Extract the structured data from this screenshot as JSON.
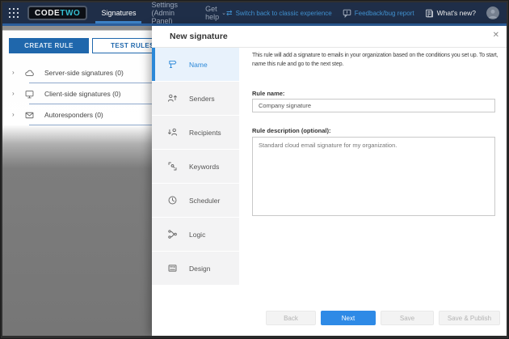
{
  "glyphs": {
    "chevron_right": "›",
    "caret_down": "⌄",
    "close": "✕",
    "switch_arrows": "⇄"
  },
  "nav": {
    "logo_part1": "CODE",
    "logo_part2": "TWO",
    "tabs": [
      {
        "label": "Signatures",
        "active": true
      },
      {
        "label": "Settings (Admin Panel)",
        "active": false
      },
      {
        "label": "Get help",
        "active": false
      }
    ],
    "links": [
      {
        "label": "Switch back to classic experience",
        "icon": "switch-arrows-icon"
      },
      {
        "label": "Feedback/bug report",
        "icon": "feedback-bubble-icon"
      },
      {
        "label": "What's new?",
        "icon": "whats-new-icon"
      }
    ]
  },
  "sidebar": {
    "create_rule_label": "CREATE RULE",
    "test_rules_label": "TEST RULES",
    "groups": [
      {
        "label": "Server-side signatures (0)",
        "icon": "cloud-icon"
      },
      {
        "label": "Client-side signatures (0)",
        "icon": "monitor-icon"
      },
      {
        "label": "Autoresponders (0)",
        "icon": "autoresponder-icon"
      }
    ]
  },
  "modal": {
    "title": "New signature",
    "steps": [
      {
        "label": "Name",
        "icon": "signpost-icon",
        "active": true
      },
      {
        "label": "Senders",
        "icon": "sender-person-icon",
        "active": false
      },
      {
        "label": "Recipients",
        "icon": "recipient-person-icon",
        "active": false
      },
      {
        "label": "Keywords",
        "icon": "keywords-brackets-icon",
        "active": false
      },
      {
        "label": "Scheduler",
        "icon": "clock-icon",
        "active": false
      },
      {
        "label": "Logic",
        "icon": "logic-branch-icon",
        "active": false
      },
      {
        "label": "Design",
        "icon": "design-layout-icon",
        "active": false
      }
    ],
    "intro": "This rule will add a signature to emails in your organization based on the conditions you set up. To start, name this rule and go to the next step.",
    "rule_name": {
      "label": "Rule name:",
      "value": "Company signature"
    },
    "rule_description": {
      "label": "Rule description (optional):",
      "value": "Standard cloud email signature for my organization."
    },
    "footer": {
      "back_label": "Back",
      "next_label": "Next",
      "save_label": "Save",
      "save_publish_label": "Save & Publish"
    }
  },
  "colors": {
    "nav_bg": "#1f2e48",
    "accent_line": "#2b5e9c",
    "primary_blue": "#1f67ac",
    "active_step_blue": "#2b88d8",
    "next_button_blue": "#2e8ae6",
    "link_blue": "#4090cf",
    "logo_teal": "#35bfd3"
  }
}
